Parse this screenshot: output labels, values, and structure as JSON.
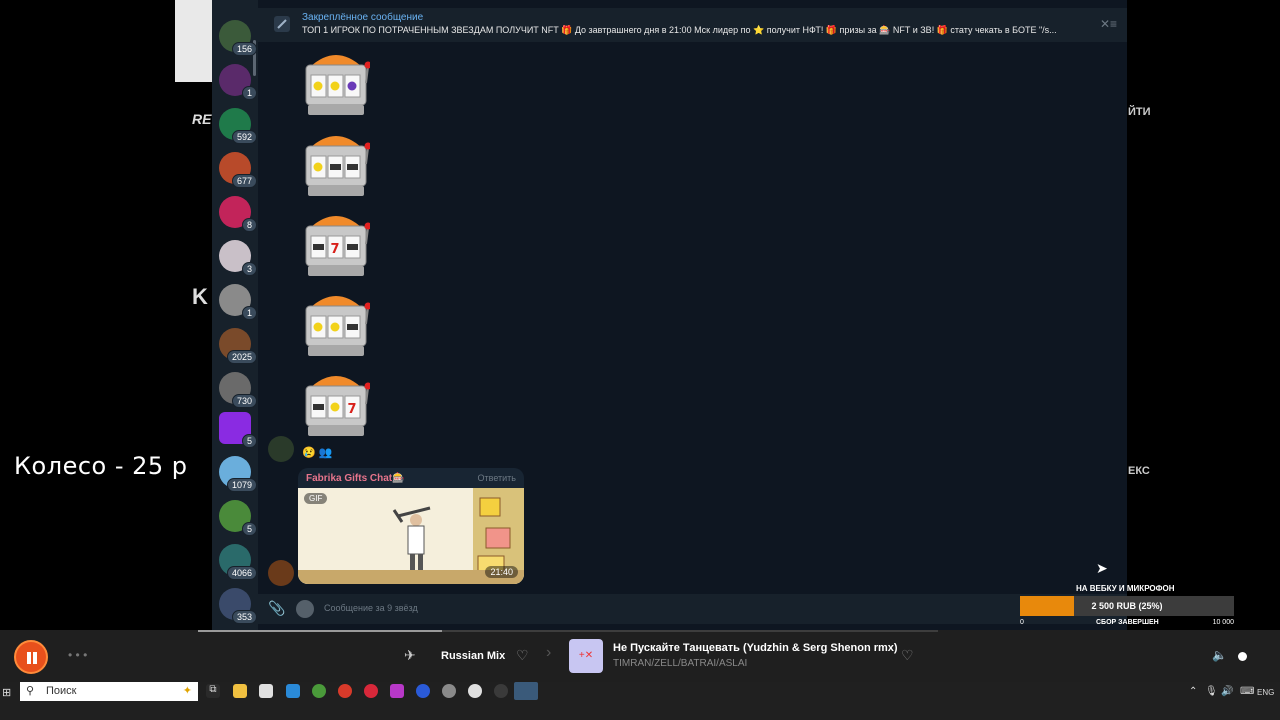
{
  "background": {
    "left_ghost_1": "RE",
    "left_ghost_2": "K",
    "right_ghost_1": "ЙТИ",
    "right_ghost_2": "ЕКС"
  },
  "overlay": {
    "wheel_text": "Колесо - 25 р"
  },
  "sidebar": {
    "badges": [
      "156",
      "1",
      "592",
      "677",
      "8",
      "3",
      "1",
      "2025",
      "730",
      "5",
      "1079",
      "5",
      "4066",
      "353"
    ]
  },
  "pinned": {
    "title": "Закреплённое сообщение",
    "text": "ТОП 1 ИГРОК ПО ПОТРАЧЕННЫМ ЗВЕЗДАМ ПОЛУЧИТ NFT 🎁 До завтрашнего дня в 21:00 Мск лидер по ⭐ получит НФТ! 🎁 призы за 🎰 NFT и ЗВ! 🎁 стату чекать в БОТЕ \"/s..."
  },
  "messages": {
    "slot_machines": [
      {
        "reels": [
          "lemon",
          "lemon",
          "grape"
        ]
      },
      {
        "reels": [
          "lemon",
          "bar",
          "bar"
        ]
      },
      {
        "reels": [
          "bar",
          "seven",
          "bar"
        ]
      },
      {
        "reels": [
          "lemon",
          "lemon",
          "bar"
        ]
      },
      {
        "reels": [
          "bar",
          "lemon",
          "seven"
        ]
      }
    ],
    "gif": {
      "sender": "Fabrika Gifts Chat🎰",
      "reply_label": "Ответить",
      "gif_label": "GIF",
      "time": "21:40"
    }
  },
  "input": {
    "placeholder": "Сообщение за 9 звёзд"
  },
  "donation": {
    "title": "НА ВЕБКУ И МИКРОФОН",
    "amount_text": "2 500 RUB (25%)",
    "progress": 0.25,
    "min": "0",
    "status": "СБОР ЗАВЕРШЕН",
    "max": "10 000",
    "fill_color": "#e8890c"
  },
  "player": {
    "progress": 0.33,
    "playlist": "Russian Mix",
    "track_title": "Не Пускайте Танцевать (Yudzhin & Serg Shenon rmx)",
    "artist": "TIMRAN/ZELL/BATRAI/ASLAI",
    "accent": "#e8501c"
  },
  "taskbar": {
    "search_placeholder": "Поиск",
    "language": "ENG"
  }
}
